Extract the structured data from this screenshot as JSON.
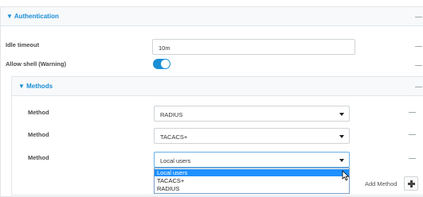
{
  "authentication": {
    "header": "▼ Authentication",
    "idle_timeout": {
      "label": "Idle timeout",
      "value": "10m"
    },
    "allow_shell": {
      "label": "Allow shell (Warning)",
      "enabled": true
    },
    "dash": "—"
  },
  "methods": {
    "header": "▼ Methods",
    "rows": [
      {
        "label": "Method",
        "value": "RADIUS"
      },
      {
        "label": "Method",
        "value": "TACACS+"
      },
      {
        "label": "Method",
        "value": "Local users"
      }
    ],
    "dropdown_options": [
      "Local users",
      "TACACS+",
      "RADIUS"
    ],
    "dropdown_selected": "Local users",
    "add_method_label": "Add Method",
    "dash": "—"
  },
  "icons": {
    "plus": "plus-icon",
    "caret": "caret-down-icon",
    "cursor": "mouse-pointer-icon"
  },
  "colors": {
    "accent": "#1a8ed6",
    "selected_option": "#1e90ff",
    "header_bg": "#f7f9fa"
  }
}
